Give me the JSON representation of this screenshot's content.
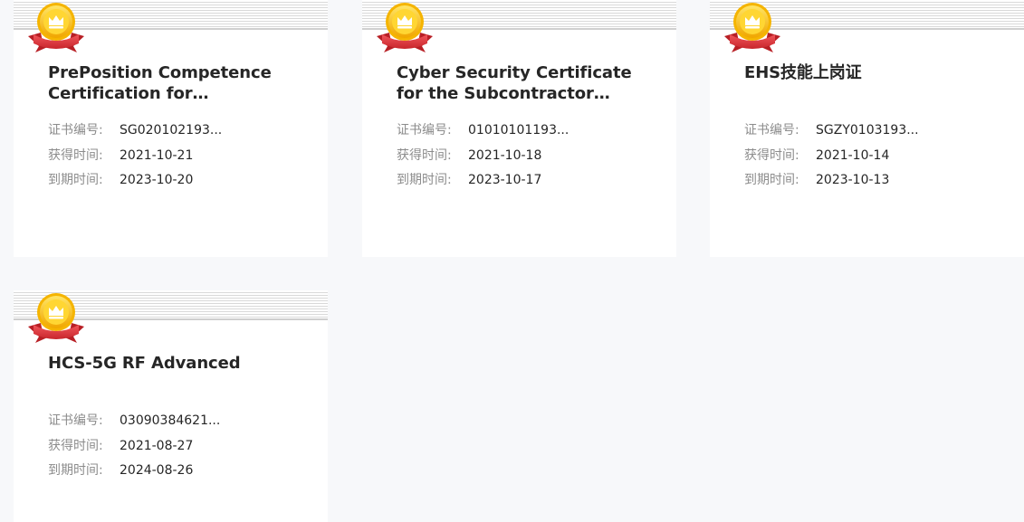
{
  "labels": {
    "cert_no": "证书编号:",
    "obtained": "获得时间:",
    "expires": "到期时间:"
  },
  "colors": {
    "page_bg": "#f7f8fa",
    "card_bg": "#ffffff",
    "title": "#262626",
    "label": "#8c8c8c",
    "medal_gold": "#f5c518",
    "ribbon_red": "#e0383e"
  },
  "icons": {
    "badge": "medal-icon"
  },
  "certificates": [
    {
      "title": "PrePosition Competence Certification for Maintenanc...",
      "cert_no": "SG020102193...",
      "obtained": "2021-10-21",
      "expires": "2023-10-20"
    },
    {
      "title": "Cyber Security Certificate for the Subcontractor Resources",
      "cert_no": "01010101193...",
      "obtained": "2021-10-18",
      "expires": "2023-10-17"
    },
    {
      "title": "EHS技能上岗证",
      "cert_no": "SGZY0103193...",
      "obtained": "2021-10-14",
      "expires": "2023-10-13"
    },
    {
      "title": "HCS-5G RF Advanced",
      "cert_no": "03090384621...",
      "obtained": "2021-08-27",
      "expires": "2024-08-26"
    }
  ]
}
